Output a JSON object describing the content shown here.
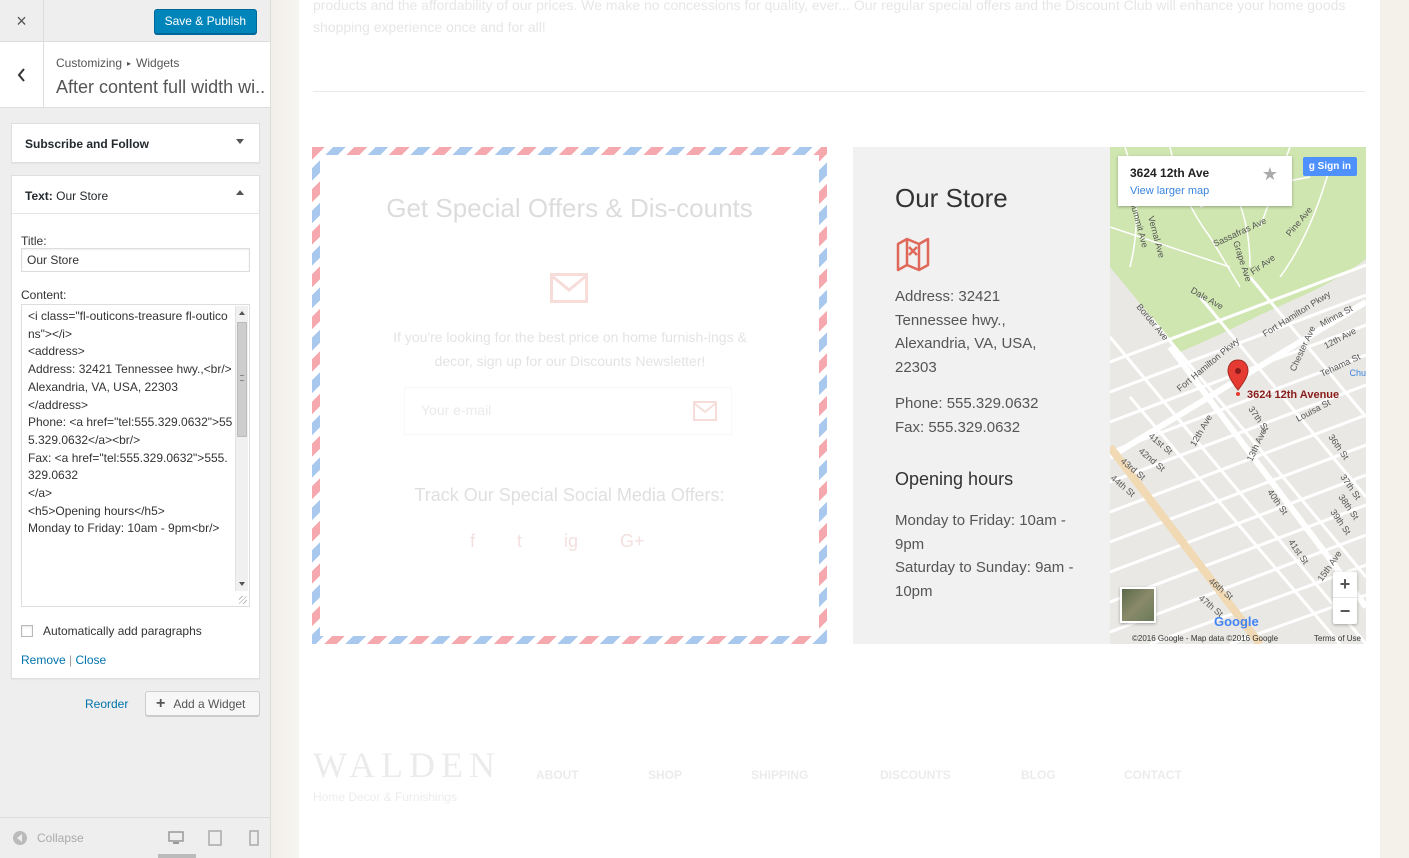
{
  "customizer": {
    "close_label": "×",
    "save_label": "Save & Publish",
    "breadcrumb": {
      "root": "Customizing",
      "sep": "▸",
      "section": "Widgets"
    },
    "section_title": "After content full width wi...",
    "widgets": [
      {
        "title": "Subscribe and Follow"
      },
      {
        "title_prefix": "Text:",
        "title_name": "Our Store"
      }
    ],
    "form": {
      "title_label": "Title:",
      "title_value": "Our Store",
      "content_label": "Content:",
      "content_value": "<i class=\"fl-outicons-treasure fl-outicons\"></i>\n<address>\nAddress: 32421 Tennessee hwy.,<br/>\nAlexandria, VA, USA, 22303\n</address>\nPhone: <a href=\"tel:555.329.0632\">555.329.0632</a><br/>\nFax: <a href=\"tel:555.329.0632\">555.329.0632\n</a>\n<h5>Opening hours</h5>\nMonday to Friday: 10am - 9pm<br/>",
      "auto_paragraphs_label": "Automatically add paragraphs",
      "auto_paragraphs_checked": false,
      "remove_label": "Remove",
      "link_sep": "|",
      "close_label": "Close"
    },
    "reorder_label": "Reorder",
    "add_widget_label": "Add a Widget",
    "collapse_label": "Collapse"
  },
  "preview": {
    "intro_text": "products and the affordability of our prices. We make no concessions for quality, ever... Our regular special offers and the Discount Club will enhance your home goods shopping experience once and for all!",
    "offers": {
      "title": "Get Special Offers & Dis-counts",
      "description": "If you're looking for the best price on home furnish-ings & decor, sign up for our Discounts Newsletter!",
      "email_placeholder": "Your e-mail",
      "track_title": "Track Our Special Social Media Offers:",
      "social": [
        "f",
        "t",
        "ig",
        "G+"
      ]
    },
    "store": {
      "title": "Our Store",
      "address": "Address: 32421 Tennessee hwy.,\nAlexandria, VA, USA, 22303",
      "phone": "Phone: 555.329.0632\nFax: 555.329.0632",
      "hours_title": "Opening hours",
      "hours": "Monday to Friday: 10am - 9pm\nSaturday to Sunday: 9am - 10pm"
    },
    "map": {
      "address": "3624 12th Ave",
      "larger_map": "View larger map",
      "sign_in": "Sign in",
      "pin_label": "3624 12th Avenue",
      "logo": "Google",
      "copyright": "©2016 Google - Map data ©2016 Google",
      "terms": "Terms of Use",
      "edge_label": "Chu",
      "street_labels": [
        "Summit Ave",
        "Vernal Ave",
        "Grape Ave",
        "Sassafras Ave",
        "Fir Ave",
        "Pine Ave",
        "Dale Ave",
        "Border Ave",
        "Fort Hamilton Pkwy",
        "Minna St",
        "12th Ave",
        "Chester Ave",
        "Tehama St",
        "Louisa St",
        "37th St",
        "13th Ave",
        "41st St",
        "42nd St",
        "43rd St",
        "44th St",
        "36th St",
        "40th St",
        "37th St",
        "38th St",
        "39th St",
        "41st St",
        "15th Ave",
        "46th St",
        "47th St"
      ]
    },
    "footer": {
      "brand": "WALDEN",
      "tagline": "Home Decor & Furnishings",
      "nav": [
        "ABOUT",
        "SHOP",
        "SHIPPING",
        "DISCOUNTS",
        "BLOG",
        "CONTACT"
      ]
    }
  }
}
